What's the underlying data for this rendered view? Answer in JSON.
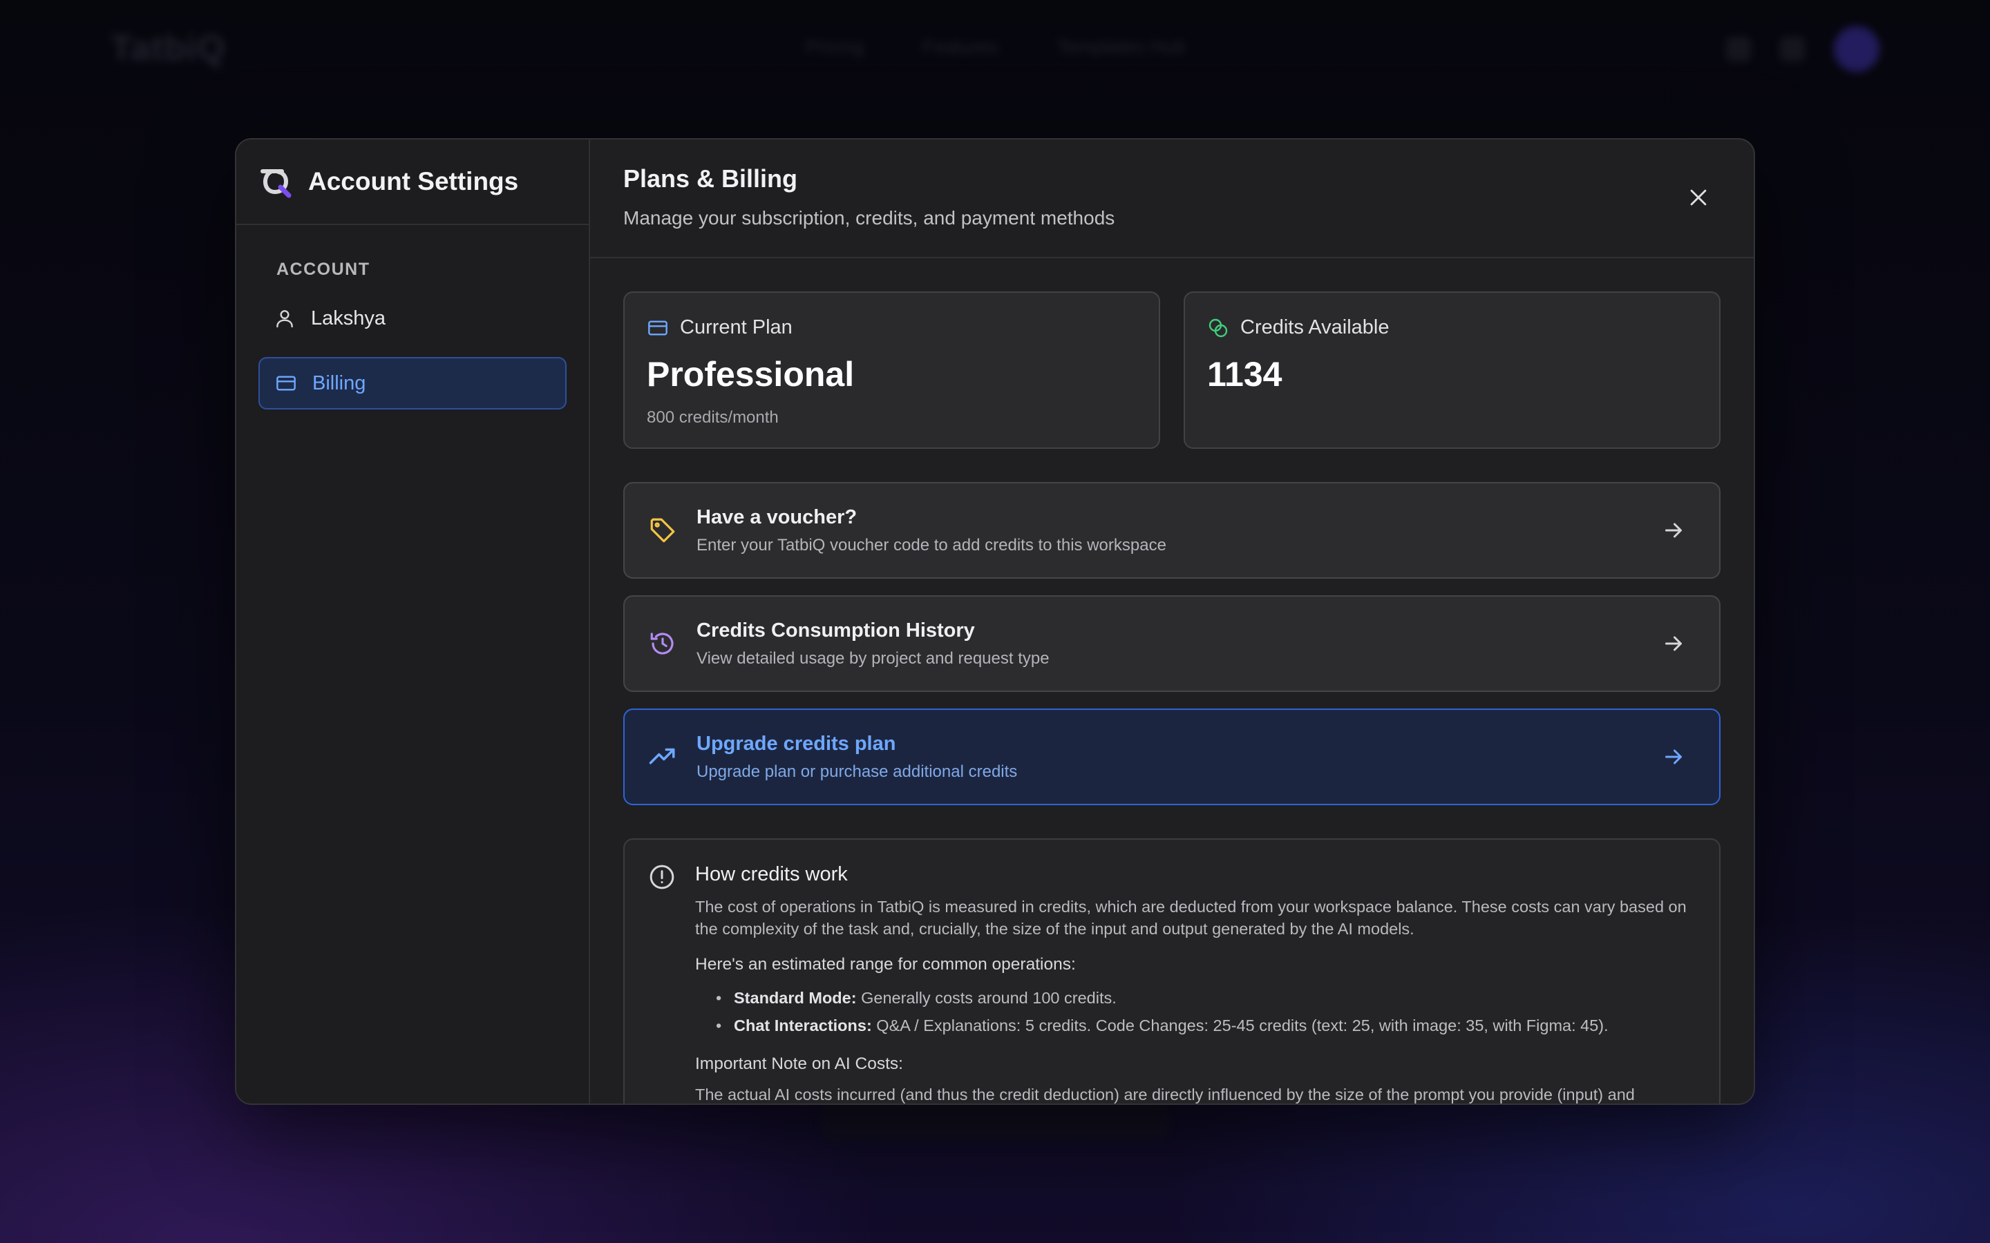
{
  "background_app": {
    "logo": "TatbiQ",
    "nav": [
      "Pricing",
      "Features",
      "Templates Hub"
    ]
  },
  "sidebar": {
    "title": "Account Settings",
    "section_label": "ACCOUNT",
    "items": [
      {
        "label": "Lakshya",
        "icon": "user-icon",
        "active": false
      },
      {
        "label": "Billing",
        "icon": "credit-card-icon",
        "active": true
      }
    ]
  },
  "header": {
    "title": "Plans & Billing",
    "subtitle": "Manage your subscription, credits, and payment methods"
  },
  "current_plan": {
    "label": "Current Plan",
    "value": "Professional",
    "note": "800 credits/month"
  },
  "credits": {
    "label": "Credits Available",
    "value": "1134"
  },
  "actions": [
    {
      "title": "Have a voucher?",
      "desc": "Enter your TatbiQ voucher code to add credits to this workspace",
      "icon": "tag-icon"
    },
    {
      "title": "Credits Consumption History",
      "desc": "View detailed usage by project and request type",
      "icon": "history-icon"
    },
    {
      "title": "Upgrade credits plan",
      "desc": "Upgrade plan or purchase additional credits",
      "icon": "trending-up-icon"
    }
  ],
  "info": {
    "title": "How credits work",
    "intro": "The cost of operations in TatbiQ is measured in credits, which are deducted from your workspace balance. These costs can vary based on the complexity of the task and, crucially, the size of the input and output generated by the AI models.",
    "range_heading": "Here's an estimated range for common operations:",
    "bullets": [
      {
        "label": "Standard Mode:",
        "text": " Generally costs around 100 credits."
      },
      {
        "label": "Chat Interactions:",
        "text": " Q&A / Explanations: 5 credits. Code Changes: 25-45 credits (text: 25, with image: 35, with Figma: 45)."
      }
    ],
    "note_heading": "Important Note on AI Costs:",
    "note_text": "The actual AI costs incurred (and thus the credit deduction) are directly influenced by the size of the prompt you provide (input) and"
  },
  "colors": {
    "accent_blue": "#6ea8ff",
    "voucher_yellow": "#f5c542",
    "history_purple": "#b48cf2",
    "credits_green": "#3fcf7a"
  }
}
